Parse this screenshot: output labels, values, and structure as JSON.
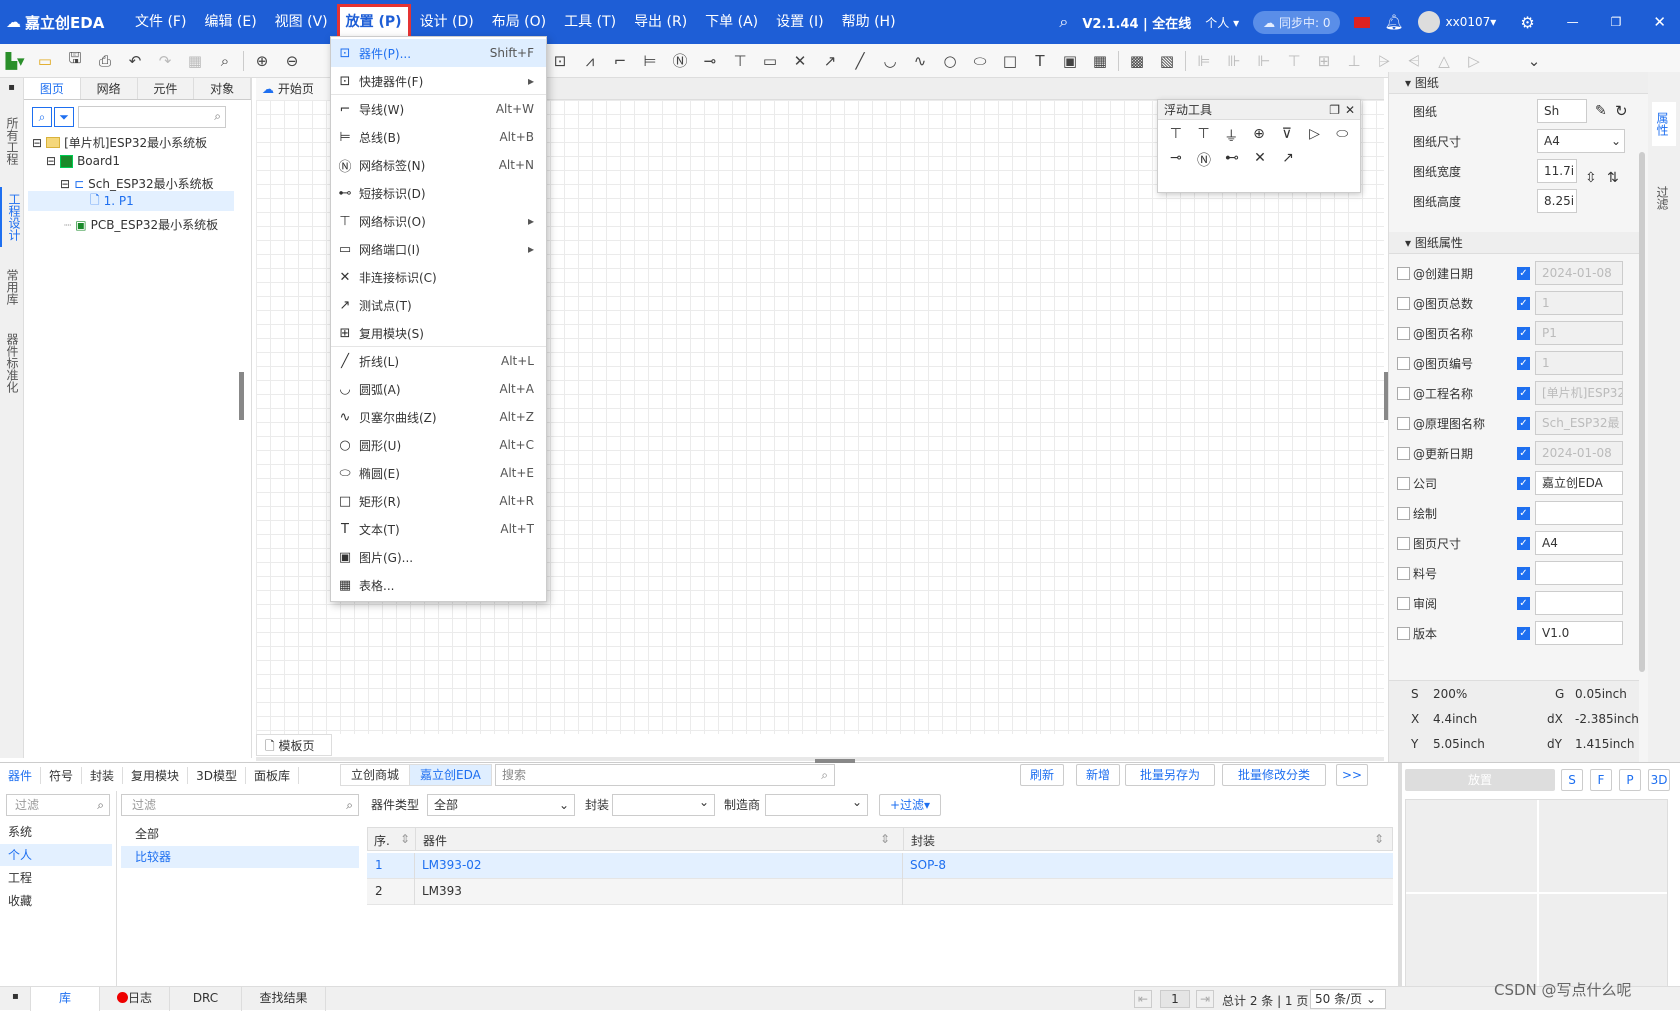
{
  "app": {
    "logo": "嘉立创EDA"
  },
  "menu": {
    "items": [
      "文件 (F)",
      "编辑 (E)",
      "视图 (V)",
      "放置 (P)",
      "设计 (D)",
      "布局 (O)",
      "工具 (T)",
      "导出 (R)",
      "下单 (A)",
      "设置 (I)",
      "帮助 (H)"
    ],
    "version": "V2.1.44 | 全在线",
    "mode": "个人",
    "sync": "同步中: 0",
    "user": "xx0107"
  },
  "left_vtabs": [
    "所有工程",
    "工程设计",
    "常用库",
    "器件标准化"
  ],
  "left_panel": {
    "tabs": [
      "图页",
      "网络",
      "元件",
      "对象"
    ],
    "tree": [
      "[单片机]ESP32最小系统板",
      "Board1",
      "Sch_ESP32最小系统板",
      "1. P1",
      "PCB_ESP32最小系统板"
    ]
  },
  "doc_tabs": {
    "start": "开始页",
    "template": "模板页"
  },
  "place_menu": [
    {
      "label": "器件(P)...",
      "shortcut": "Shift+F",
      "icon": "component-icon"
    },
    {
      "label": "快捷器件(F)",
      "shortcut": "▸",
      "icon": "component-icon"
    },
    {
      "label": "导线(W)",
      "shortcut": "Alt+W",
      "icon": "wire-icon"
    },
    {
      "label": "总线(B)",
      "shortcut": "Alt+B",
      "icon": "bus-icon"
    },
    {
      "label": "网络标签(N)",
      "shortcut": "Alt+N",
      "icon": "net-label-icon"
    },
    {
      "label": "短接标识(D)",
      "shortcut": "",
      "icon": "short-flag-icon"
    },
    {
      "label": "网络标识(O)",
      "shortcut": "▸",
      "icon": "net-flag-icon"
    },
    {
      "label": "网络端口(I)",
      "shortcut": "▸",
      "icon": "net-port-icon"
    },
    {
      "label": "非连接标识(C)",
      "shortcut": "",
      "icon": "no-connect-icon"
    },
    {
      "label": "测试点(T)",
      "shortcut": "",
      "icon": "test-point-icon"
    },
    {
      "label": "复用模块(S)",
      "shortcut": "",
      "icon": "reuse-block-icon"
    },
    {
      "label": "折线(L)",
      "shortcut": "Alt+L",
      "icon": "polyline-icon"
    },
    {
      "label": "圆弧(A)",
      "shortcut": "Alt+A",
      "icon": "arc-icon"
    },
    {
      "label": "贝塞尔曲线(Z)",
      "shortcut": "Alt+Z",
      "icon": "bezier-icon"
    },
    {
      "label": "圆形(U)",
      "shortcut": "Alt+C",
      "icon": "circle-icon"
    },
    {
      "label": "椭圆(E)",
      "shortcut": "Alt+E",
      "icon": "ellipse-icon"
    },
    {
      "label": "矩形(R)",
      "shortcut": "Alt+R",
      "icon": "rectangle-icon"
    },
    {
      "label": "文本(T)",
      "shortcut": "Alt+T",
      "icon": "text-icon"
    },
    {
      "label": "图片(G)...",
      "shortcut": "",
      "icon": "image-icon"
    },
    {
      "label": "表格...",
      "shortcut": "",
      "icon": "table-icon"
    }
  ],
  "float_tools": {
    "title": "浮动工具"
  },
  "right_panel": {
    "sheet_section": "图纸",
    "sheet_rows": [
      {
        "label": "图纸",
        "value": "Sh"
      },
      {
        "label": "图纸尺寸",
        "value": "A4"
      },
      {
        "label": "图纸宽度",
        "value": "11.7i"
      },
      {
        "label": "图纸高度",
        "value": "8.25i"
      }
    ],
    "attr_section": "图纸属性",
    "attrs": [
      {
        "label": "@创建日期",
        "value": "2024-01-08",
        "disabled": true
      },
      {
        "label": "@图页总数",
        "value": "1",
        "disabled": true
      },
      {
        "label": "@图页名称",
        "value": "P1",
        "disabled": true
      },
      {
        "label": "@图页编号",
        "value": "1",
        "disabled": true
      },
      {
        "label": "@工程名称",
        "value": "[单片机]ESP32",
        "disabled": true
      },
      {
        "label": "@原理图名称",
        "value": "Sch_ESP32最",
        "disabled": true
      },
      {
        "label": "@更新日期",
        "value": "2024-01-08",
        "disabled": true
      },
      {
        "label": "公司",
        "value": "嘉立创EDA",
        "disabled": false
      },
      {
        "label": "绘制",
        "value": "",
        "disabled": false
      },
      {
        "label": "图页尺寸",
        "value": "A4",
        "disabled": false
      },
      {
        "label": "料号",
        "value": "",
        "disabled": false
      },
      {
        "label": "审阅",
        "value": "",
        "disabled": false
      },
      {
        "label": "版本",
        "value": "V1.0",
        "disabled": false
      }
    ],
    "coords": {
      "s": "200%",
      "g": "0.05inch",
      "x": "4.4inch",
      "dx": "-2.385inch",
      "y": "5.05inch",
      "dy": "1.415inch"
    },
    "side_tabs": [
      "属性",
      "过滤"
    ]
  },
  "bottom": {
    "tabs": [
      "器件",
      "符号",
      "封装",
      "复用模块",
      "3D模型",
      "面板库"
    ],
    "shops": [
      "立创商城",
      "嘉立创EDA"
    ],
    "search_placeholder": "搜索",
    "buttons": [
      "刷新",
      "新增",
      "批量另存为",
      "批量修改分类",
      ">>"
    ],
    "filter_placeholder": "过滤",
    "categories": [
      "系统",
      "个人",
      "工程",
      "收藏"
    ],
    "subcategories": [
      "全部",
      "比较器"
    ],
    "fields": {
      "type_label": "器件类型",
      "type_value": "全部",
      "pkg_label": "封装",
      "mfr_label": "制造商",
      "more": "+过滤▾"
    },
    "table_headers": [
      "序.",
      "器件",
      "封装"
    ],
    "rows": [
      {
        "no": "1",
        "device": "LM393-02",
        "package": "SOP-8"
      },
      {
        "no": "2",
        "device": "LM393",
        "package": ""
      }
    ],
    "place_btn": "放置",
    "view_btns": [
      "S",
      "F",
      "P",
      "3D"
    ]
  },
  "status": {
    "tabs": [
      "库",
      "日志",
      "DRC",
      "查找结果"
    ],
    "page": "1",
    "summary": "总计 2 条 | 1 页",
    "per_page": "50 条/页",
    "watermark": "CSDN @写点什么呢"
  }
}
